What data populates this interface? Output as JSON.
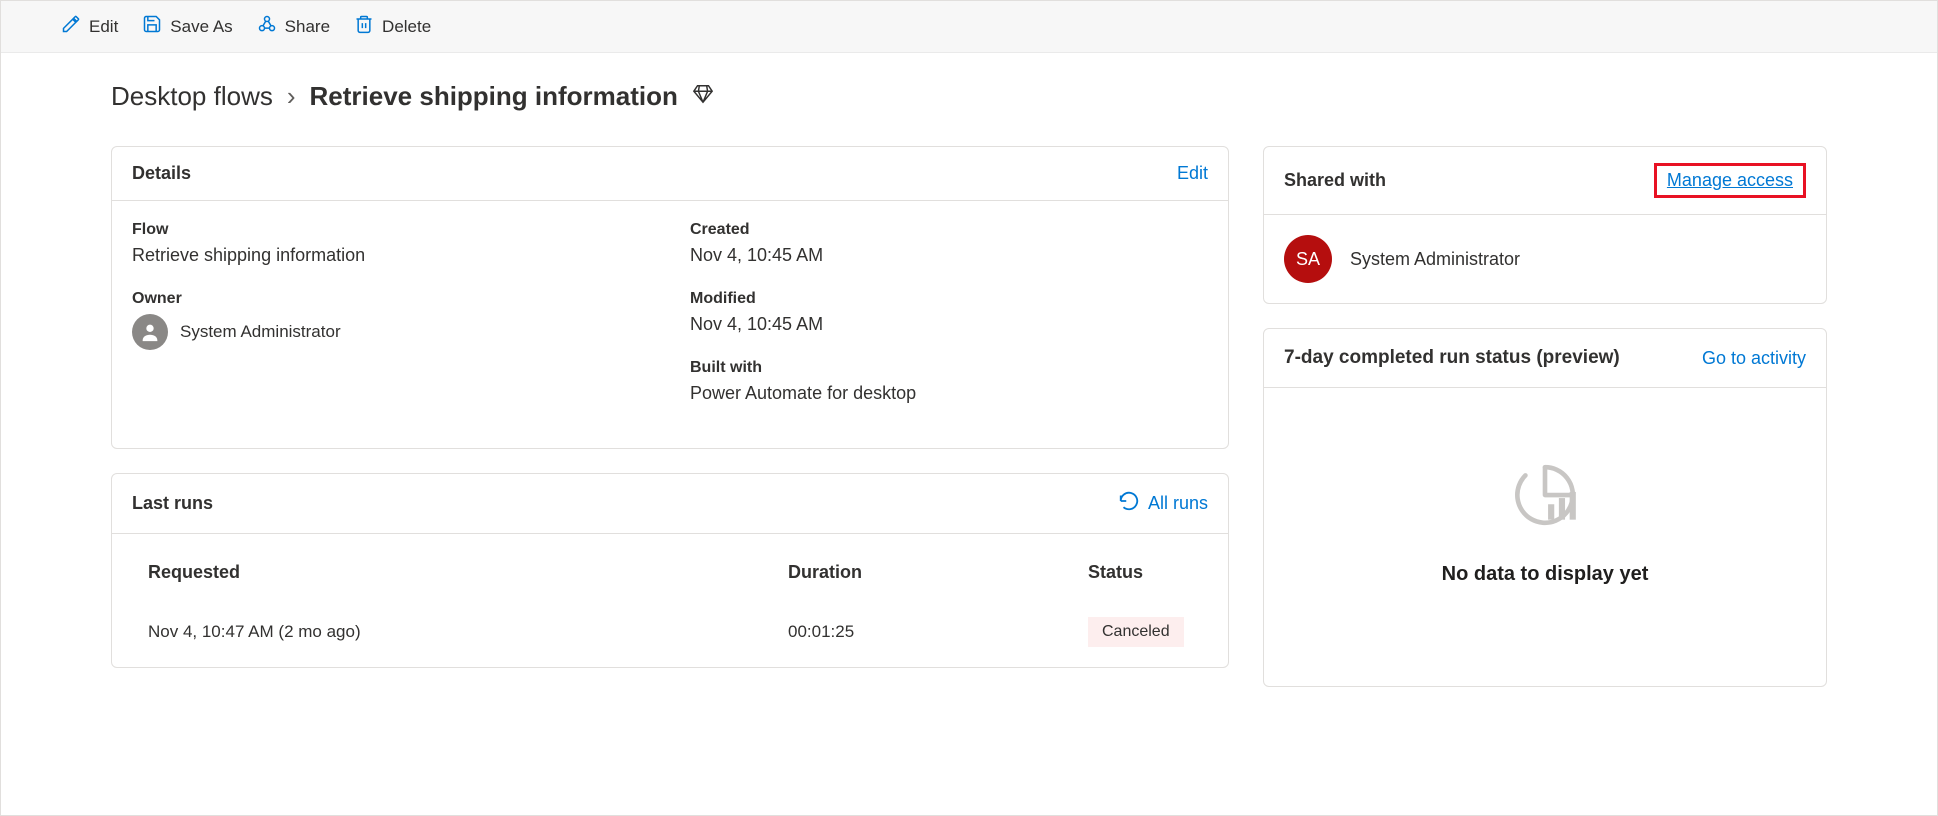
{
  "toolbar": {
    "edit": "Edit",
    "save_as": "Save As",
    "share": "Share",
    "delete": "Delete"
  },
  "breadcrumb": {
    "parent": "Desktop flows",
    "current": "Retrieve shipping information"
  },
  "details": {
    "title": "Details",
    "edit_link": "Edit",
    "flow_label": "Flow",
    "flow_value": "Retrieve shipping information",
    "owner_label": "Owner",
    "owner_value": "System Administrator",
    "created_label": "Created",
    "created_value": "Nov 4, 10:45 AM",
    "modified_label": "Modified",
    "modified_value": "Nov 4, 10:45 AM",
    "built_label": "Built with",
    "built_value": "Power Automate for desktop"
  },
  "last_runs": {
    "title": "Last runs",
    "all_runs": "All runs",
    "columns": {
      "requested": "Requested",
      "duration": "Duration",
      "status": "Status"
    },
    "rows": [
      {
        "requested": "Nov 4, 10:47 AM (2 mo ago)",
        "duration": "00:01:25",
        "status": "Canceled"
      }
    ]
  },
  "shared": {
    "title": "Shared with",
    "manage_link": "Manage access",
    "avatar_initials": "SA",
    "user_name": "System Administrator"
  },
  "run_status": {
    "title": "7-day completed run status (preview)",
    "go_link": "Go to activity",
    "no_data": "No data to display yet"
  }
}
